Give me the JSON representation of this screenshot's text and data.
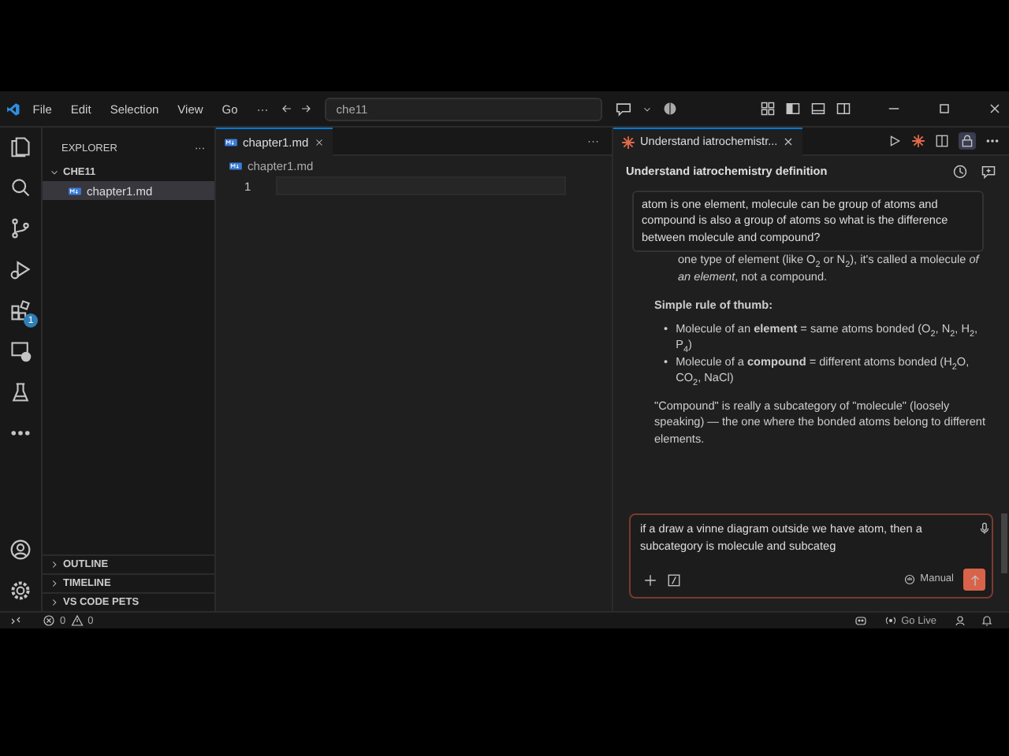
{
  "menu": [
    "File",
    "Edit",
    "Selection",
    "View",
    "Go",
    "···"
  ],
  "command_center": "che11",
  "activity_bar": {
    "extensions_badge": "1"
  },
  "explorer": {
    "title": "EXPLORER",
    "more": "···",
    "folder": {
      "name": "CHE11",
      "expanded": true,
      "children": [
        {
          "name": "chapter1.md",
          "selected": true
        }
      ]
    },
    "sections": [
      {
        "label": "OUTLINE",
        "expanded": false
      },
      {
        "label": "TIMELINE",
        "expanded": false
      },
      {
        "label": "VS CODE PETS",
        "expanded": false
      }
    ]
  },
  "editor": {
    "tab": "chapter1.md",
    "breadcrumb": "chapter1.md",
    "line_numbers": [
      "1"
    ],
    "more": "···"
  },
  "chat": {
    "tab": "Understand iatrochemistr...",
    "title": "Understand iatrochemistry definition",
    "user_message": "atom is one element, molecule can be group of atoms and compound is also a group of atoms so what is the difference between molecule and compound?",
    "response": [
      {
        "kind": "continuation",
        "text": "one type of element (like O$_{2}$ or N$_{2}$), it's called a molecule *of an element*, not a compound."
      },
      {
        "kind": "heading",
        "text": "Simple rule of thumb:"
      },
      {
        "kind": "bullets",
        "items": [
          {
            "marker": "•",
            "text": "Molecule of an **element** = same atoms bonded (O$_{2}$, N$_{2}$, H$_{2}$, P$_{4}$)"
          },
          {
            "marker": "•",
            "text": "Molecule of a **compound** = different atoms bonded (H$_{2}$O, CO$_{2}$, NaCl)"
          }
        ]
      },
      {
        "kind": "paragraph",
        "text": "\"Compound\" is really a subcategory of \"molecule\" (loosely speaking) — the one where the bonded atoms belong to different elements."
      }
    ],
    "input": {
      "value": "if a draw a vinne diagram outside we have atom, then a subcategory is molecule and subcateg",
      "mode": "Manual"
    }
  },
  "status_bar": {
    "errors": "0",
    "warnings": "0",
    "go_live": "Go Live"
  }
}
